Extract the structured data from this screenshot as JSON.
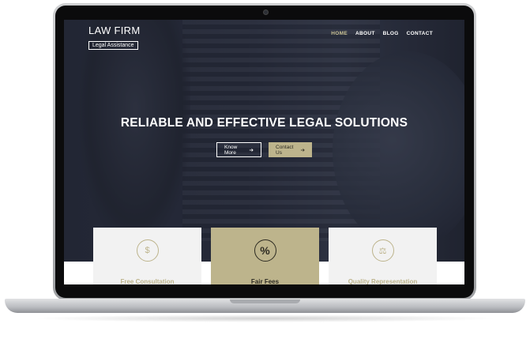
{
  "header": {
    "logo_title": "LAW FIRM",
    "logo_subtitle": "Legal Assistance",
    "nav": [
      {
        "label": "HOME",
        "active": true
      },
      {
        "label": "ABOUT"
      },
      {
        "label": "BLOG"
      },
      {
        "label": "CONTACT"
      }
    ]
  },
  "hero": {
    "headline": "RELIABLE AND EFFECTIVE LEGAL SOLUTIONS",
    "buttons": {
      "primary": "Know More",
      "secondary": "Contact Us",
      "arrow": "➔"
    }
  },
  "features": [
    {
      "title": "Free Consultation",
      "icon": "cash-icon",
      "glyph": "$"
    },
    {
      "title": "Fair Fees",
      "icon": "percent-icon",
      "glyph": "%"
    },
    {
      "title": "Quality Representation",
      "icon": "scales-icon",
      "glyph": "⚖"
    }
  ],
  "colors": {
    "accent": "#bdb48c",
    "dark": "#2d2b22"
  }
}
